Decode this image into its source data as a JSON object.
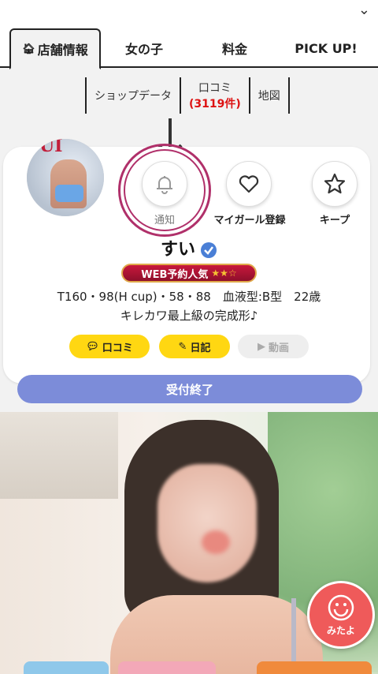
{
  "top_chevron": "⌄",
  "tabs": [
    {
      "label": "店舗情報",
      "icon": "home-icon",
      "active": true
    },
    {
      "label": "女の子"
    },
    {
      "label": "料金"
    },
    {
      "label": "PICK UP!"
    }
  ],
  "subnav": {
    "shop_data": "ショップデータ",
    "reviews_label": "口コミ",
    "reviews_count": "(3119件)",
    "map": "地図"
  },
  "profile": {
    "avatar_text": "SUI",
    "name": "すい",
    "badge_text": "WEB予約人気",
    "badge_stars": "★★☆",
    "stats": "T160・98(H cup)・58・88　血液型:B型　22歳",
    "catchphrase": "キレカワ最上級の完成形♪"
  },
  "actions": {
    "notify": "通知",
    "my_girl": "マイガール登録",
    "keep": "キープ"
  },
  "pills": {
    "review": "口コミ",
    "diary": "日記",
    "video": "動画"
  },
  "status_label": "受付終了",
  "mitayo_label": "みたよ",
  "colors": {
    "accent_red": "#d11111",
    "status_bar": "#7c8cd9",
    "pill_yellow": "#ffd712",
    "mitayo": "#ef5a5a",
    "badge": "#c8183c",
    "highlight_ring": "#b0306a"
  }
}
